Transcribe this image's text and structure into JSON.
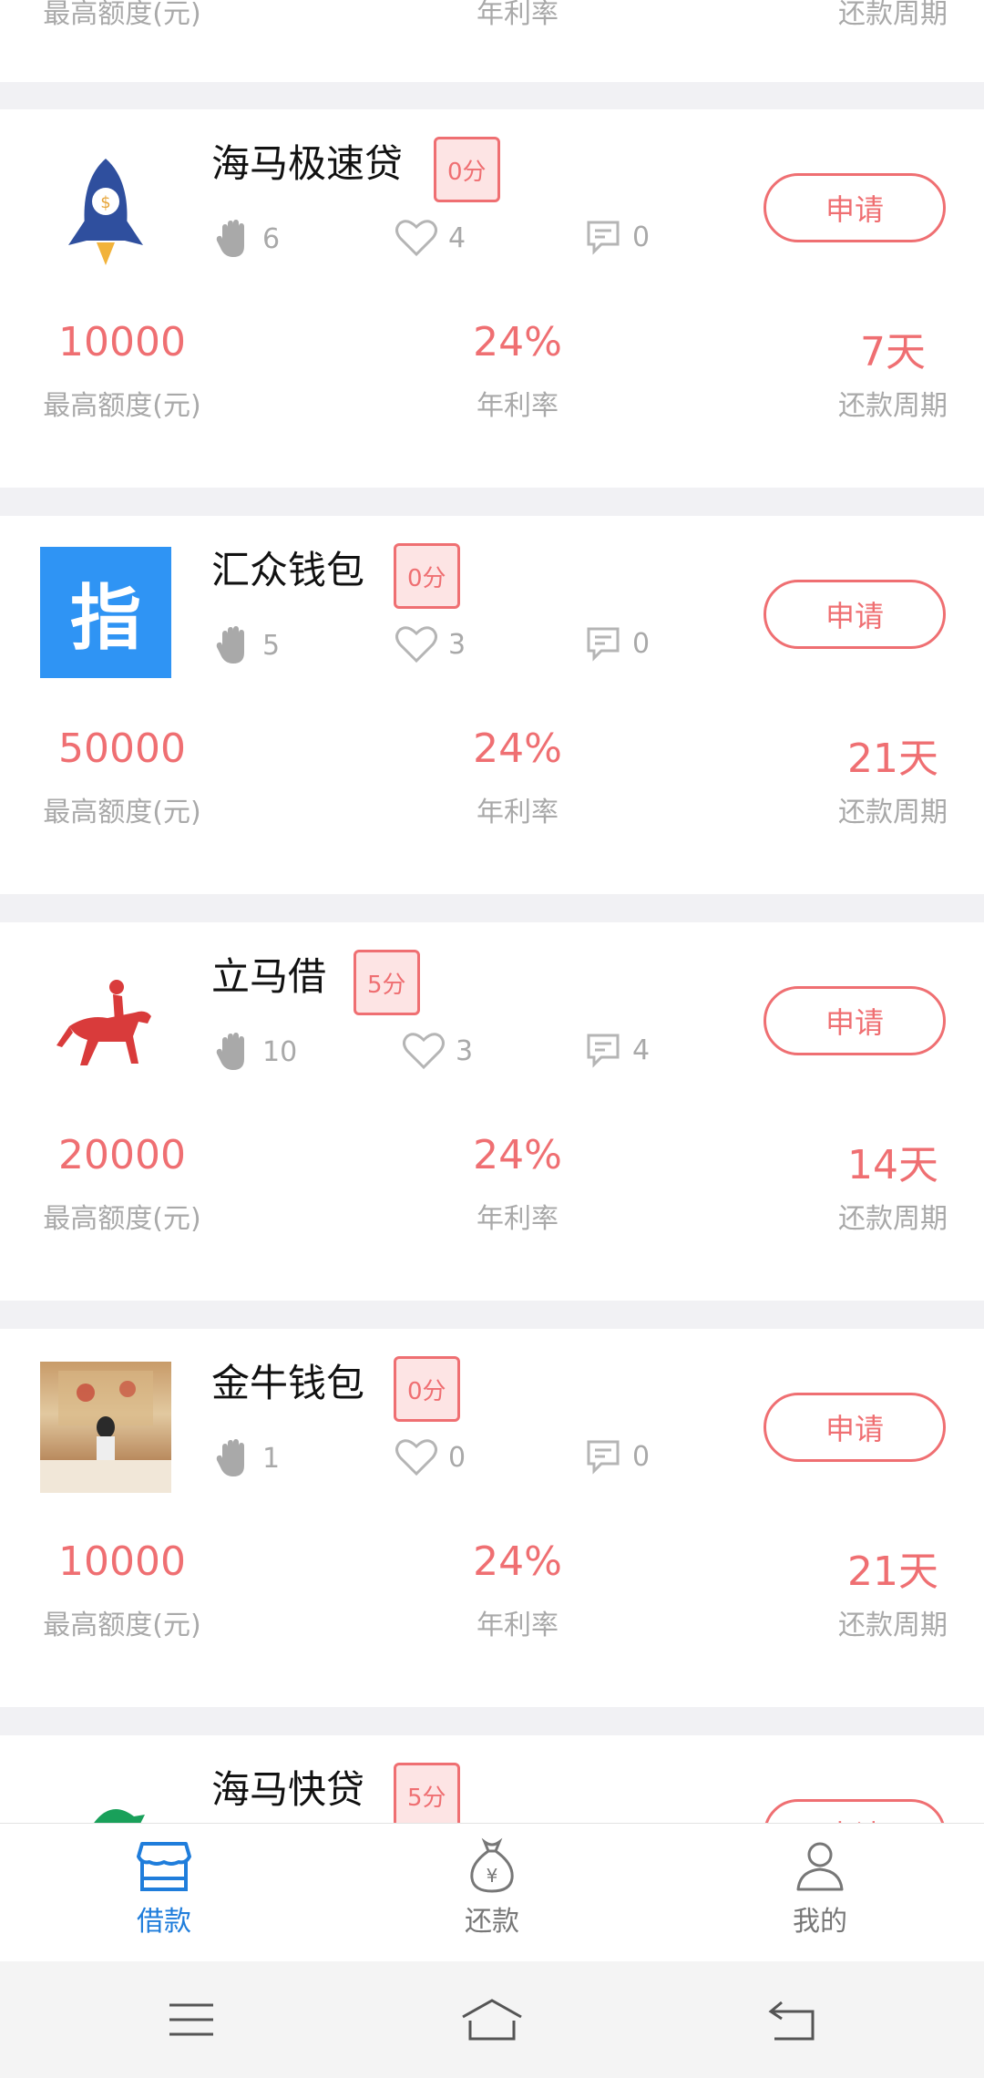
{
  "top_partial": {
    "labels": [
      "最高额度(元)",
      "年利率",
      "还款周期"
    ]
  },
  "loans": [
    {
      "name": "海马极速贷",
      "score": "0分",
      "likes": "6",
      "favorites": "4",
      "comments": "0",
      "apply_label": "申请",
      "amount": "10000",
      "amount_label": "最高额度(元)",
      "rate": "24%",
      "rate_label": "年利率",
      "period": "7天",
      "period_label": "还款周期",
      "logo": "rocket-icon"
    },
    {
      "name": "汇众钱包",
      "score": "0分",
      "likes": "5",
      "favorites": "3",
      "comments": "0",
      "apply_label": "申请",
      "amount": "50000",
      "amount_label": "最高额度(元)",
      "rate": "24%",
      "rate_label": "年利率",
      "period": "21天",
      "period_label": "还款周期",
      "logo_text": "指"
    },
    {
      "name": "立马借",
      "score": "5分",
      "likes": "10",
      "favorites": "3",
      "comments": "4",
      "apply_label": "申请",
      "amount": "20000",
      "amount_label": "最高额度(元)",
      "rate": "24%",
      "rate_label": "年利率",
      "period": "14天",
      "period_label": "还款周期",
      "logo": "horse-rider-icon"
    },
    {
      "name": "金牛钱包",
      "score": "0分",
      "likes": "1",
      "favorites": "0",
      "comments": "0",
      "apply_label": "申请",
      "amount": "10000",
      "amount_label": "最高额度(元)",
      "rate": "24%",
      "rate_label": "年利率",
      "period": "21天",
      "period_label": "还款周期",
      "logo": "photo-logo"
    },
    {
      "name": "海马快贷",
      "score": "5分",
      "apply_label": "申请",
      "logo": "seahorse-icon"
    }
  ],
  "tabs": [
    {
      "label": "借款",
      "icon": "shop-icon",
      "active": true
    },
    {
      "label": "还款",
      "icon": "money-bag-icon",
      "active": false
    },
    {
      "label": "我的",
      "icon": "user-icon",
      "active": false
    }
  ],
  "colors": {
    "accent": "#ef6f72",
    "tab_active": "#1f7ddb",
    "muted": "#a9a9a9",
    "logo_blue": "#2f94f4"
  }
}
